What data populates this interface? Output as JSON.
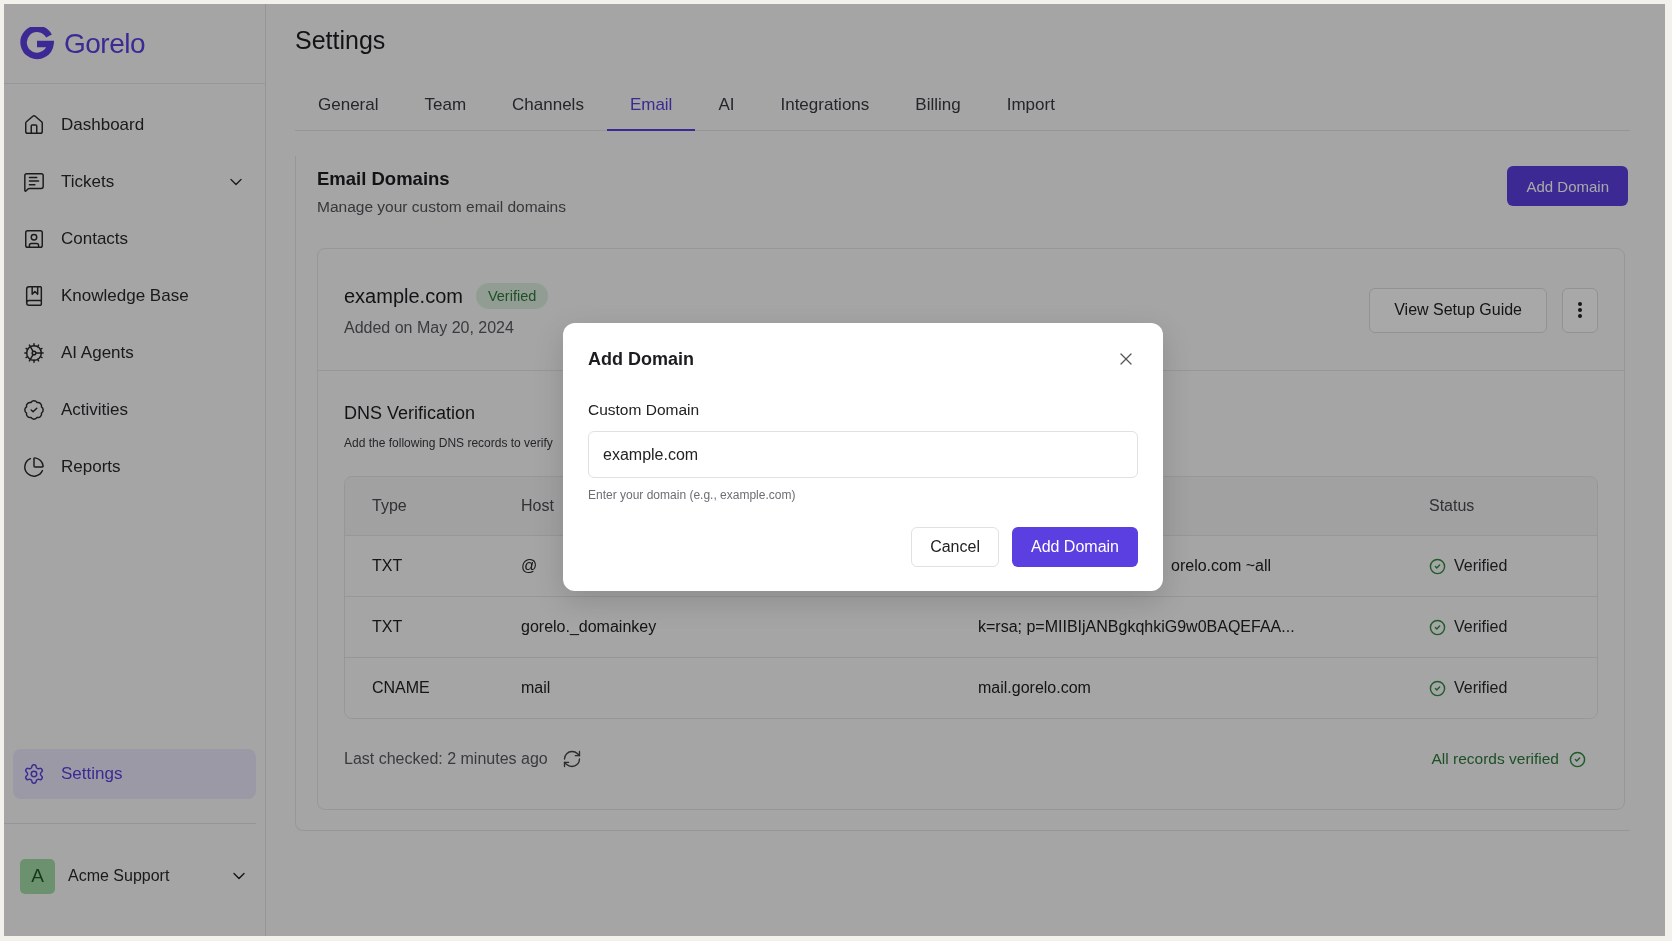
{
  "sidebar": {
    "brand": "Gorelo",
    "items": [
      {
        "label": "Dashboard",
        "kind": "link",
        "selected": false
      },
      {
        "label": "Tickets",
        "kind": "group",
        "selected": false
      },
      {
        "label": "Contacts",
        "kind": "link",
        "selected": false
      },
      {
        "label": "Knowledge Base",
        "kind": "link",
        "selected": false
      },
      {
        "label": "AI Agents",
        "kind": "link",
        "selected": false
      },
      {
        "label": "Activities",
        "kind": "link",
        "selected": false
      },
      {
        "label": "Reports",
        "kind": "link",
        "selected": false
      }
    ],
    "bottom_item": {
      "label": "Settings",
      "selected": true
    },
    "account": {
      "initial": "A",
      "name": "Acme Support"
    }
  },
  "page": {
    "title": "Settings",
    "tabs": [
      {
        "label": "General",
        "selected": false
      },
      {
        "label": "Team",
        "selected": false
      },
      {
        "label": "Channels",
        "selected": false
      },
      {
        "label": "Email",
        "selected": true
      },
      {
        "label": "AI",
        "selected": false
      },
      {
        "label": "Integrations",
        "selected": false
      },
      {
        "label": "Billing",
        "selected": false
      },
      {
        "label": "Import",
        "selected": false
      }
    ]
  },
  "email_domains": {
    "title": "Email Domains",
    "subtitle": "Manage your custom email domains",
    "add_button": "Add Domain",
    "domain": {
      "name": "example.com",
      "badge": "Verified",
      "added": "Added on May 20, 2024",
      "guide_button": "View Setup Guide"
    },
    "dns": {
      "title": "DNS Verification",
      "description": "Add the following DNS records to verify",
      "header": {
        "type": "Type",
        "host": "Host",
        "status": "Status"
      },
      "rows": [
        {
          "type": "TXT",
          "host": "@",
          "value": "orelo.com ~all",
          "status": "Verified"
        },
        {
          "type": "TXT",
          "host": "gorelo._domainkey",
          "value": "k=rsa; p=MIIBIjANBgkqhkiG9w0BAQEFAA...",
          "status": "Verified"
        },
        {
          "type": "CNAME",
          "host": "mail",
          "value": "mail.gorelo.com",
          "status": "Verified"
        }
      ],
      "last_checked": "Last checked: 2 minutes ago",
      "summary": "All records verified"
    }
  },
  "dialog": {
    "title": "Add Domain",
    "field_label": "Custom Domain",
    "field_value": "example.com",
    "hint": "Enter your domain (e.g., example.com)",
    "cancel": "Cancel",
    "confirm": "Add Domain"
  }
}
